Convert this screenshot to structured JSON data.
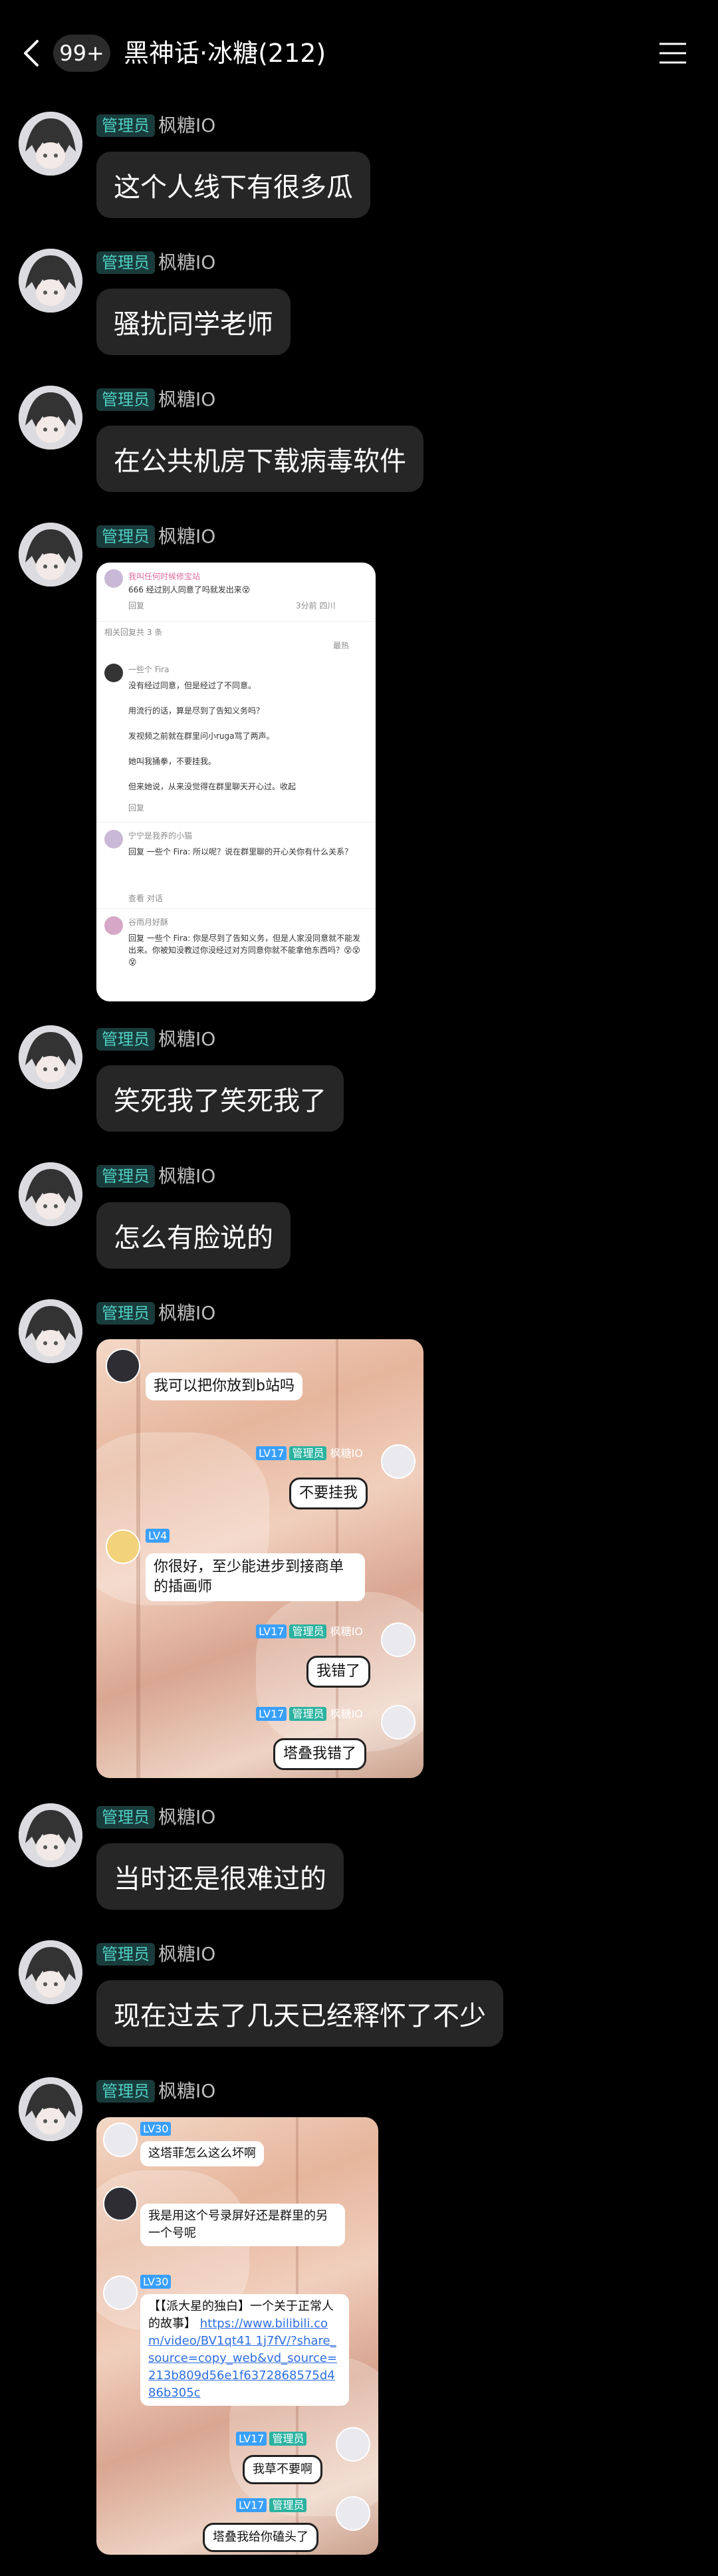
{
  "header": {
    "unread_badge": "99+",
    "title": "黑神话·冰糖(212)"
  },
  "sender": {
    "role": "管理员",
    "name": "枫糖IO"
  },
  "messages": [
    {
      "type": "text",
      "text": "这个人线下有很多瓜"
    },
    {
      "type": "text",
      "text": "骚扰同学老师"
    },
    {
      "type": "text",
      "text": "在公共机房下载病毒软件"
    },
    {
      "type": "image",
      "kind": "forum-screenshot"
    },
    {
      "type": "text",
      "text": "笑死我了笑死我了"
    },
    {
      "type": "text",
      "text": "怎么有脸说的"
    },
    {
      "type": "image",
      "kind": "chat-screenshot-1"
    },
    {
      "type": "text",
      "text": "当时还是很难过的"
    },
    {
      "type": "text",
      "text": "现在过去了几天已经释怀了不少"
    },
    {
      "type": "image",
      "kind": "chat-screenshot-2"
    }
  ],
  "forum": {
    "top_user": "我叫任何时候修宝站",
    "top_text": "666 经过别人同意了吗就发出来😵",
    "top_meta": "3分前 四川",
    "reply_count_label": "相关回复共 3 条",
    "sort_label": "最热",
    "reply1_user": "一些个 Fira",
    "reply1_lines": [
      "没有经过同意，但是经过了不同意。",
      "用流行的话，算是尽到了告知义务吗？",
      "发视频之前就在群里问小ruga骂了两声。",
      "她叫我捅拳，不要挂我。",
      "但来她说，从来没觉得在群里聊天开心过。收起"
    ],
    "reply2_user": "宁宁是我养的小猫",
    "reply2_text": "回复 一些个 Fira: 所以呢？说在群里聊的开心关你有什么关系？",
    "reply2_more": "查看 对话",
    "reply3_user": "谷雨月好酥",
    "reply3_text": "回复 一些个 Fira: 你是尽到了告知义务，但是人家没同意就不能发出来。你被知没教过你没经过对方同意你就不能拿他东西吗？😵😵😵",
    "reply_label": "回复"
  },
  "chat1": {
    "b1": "我可以把你放到b站吗",
    "tag1_lv": "LV17",
    "tag1_role": "管理员",
    "tag1_name": "枫糖IO",
    "b2": "不要挂我",
    "tag2_lv": "LV4",
    "b3": "你很好，至少能进步到接商单的插画师",
    "b4": "我错了",
    "b5": "塔叠我错了"
  },
  "chat2": {
    "tag_lv": "LV30",
    "b1": "这塔菲怎么这么坏啊",
    "b2": "我是用这个号录屏好还是群里的另一个号呢",
    "b3_text": "【【派大星的独白】一个关于正常人的故事】",
    "b3_link": "https://www.bilibili.com/video/BV1qt41 1j7fV/?share_source=copy_web&vd_source=213b809d56e1f6372868575d486b305c",
    "b4": "我草不要啊",
    "b5": "塔叠我给你磕头了",
    "tag_lv2": "LV17",
    "tag_role": "管理员"
  },
  "colors": {
    "background": "#000000",
    "bubble": "#262626",
    "role_badge_text": "#4fd1c5",
    "role_badge_bg": "#1a3b3b"
  }
}
